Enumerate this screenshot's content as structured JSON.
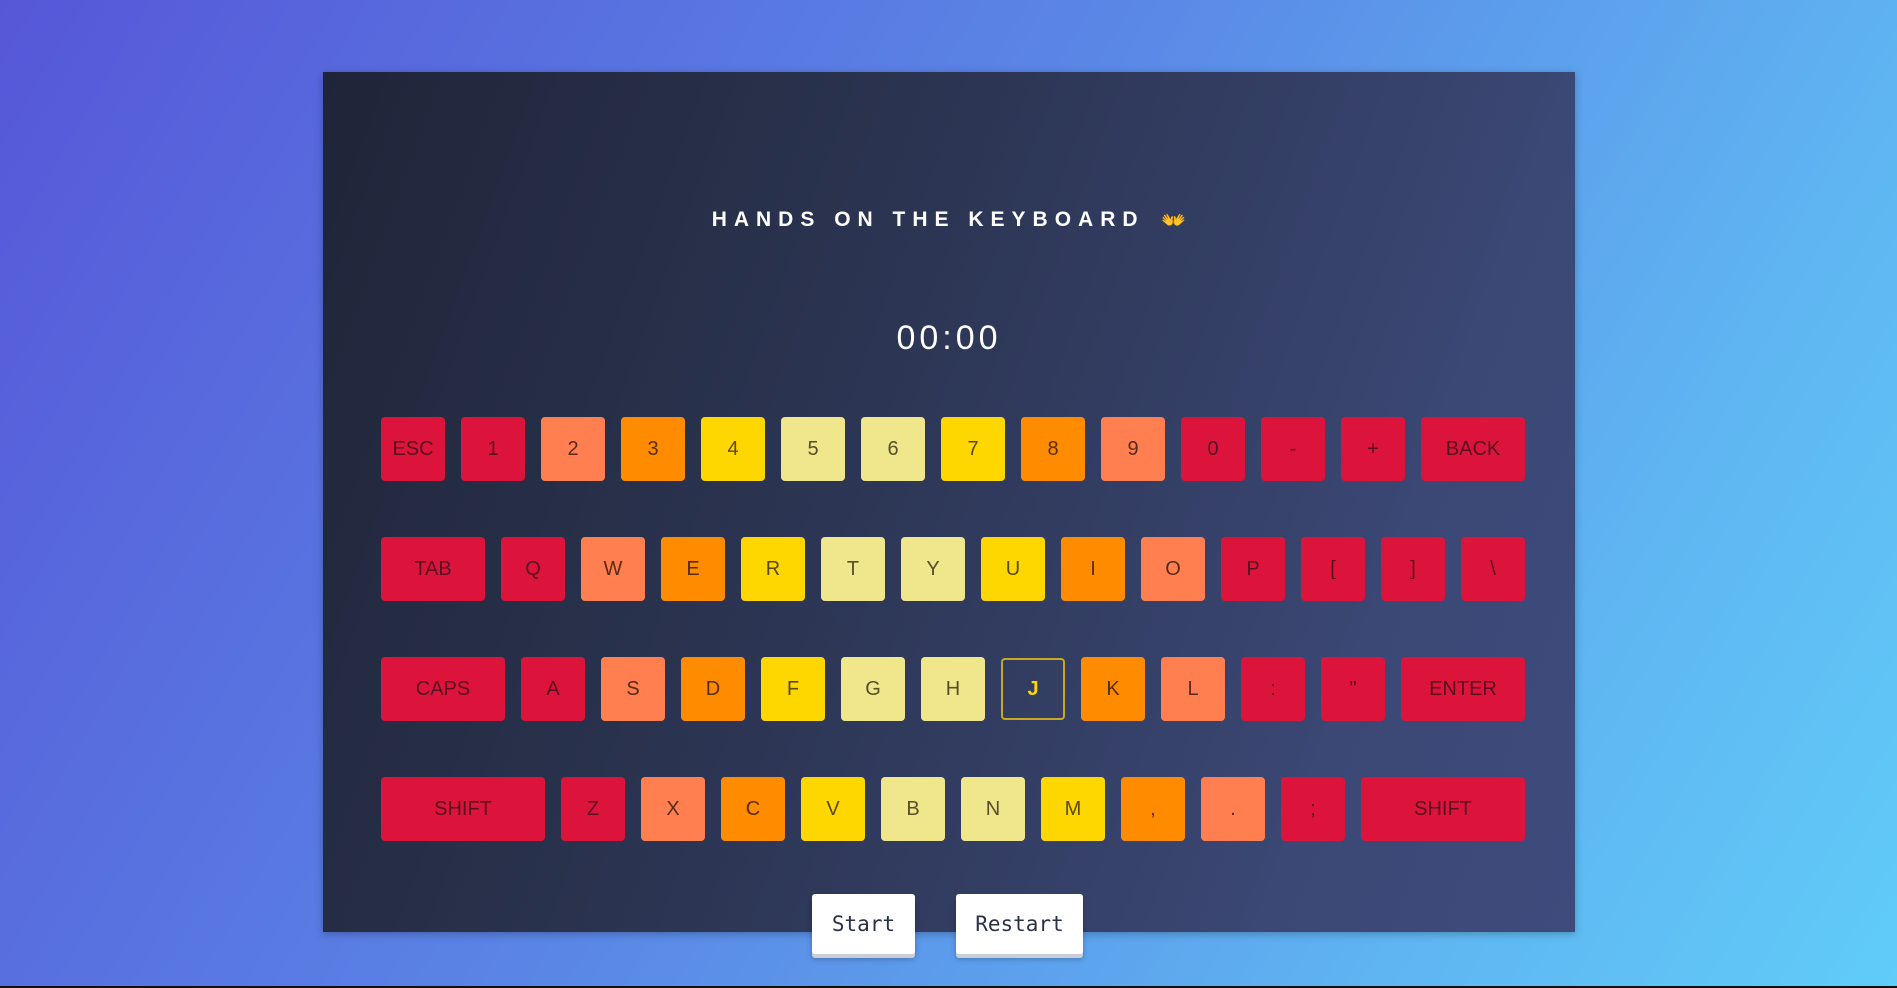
{
  "title": "HANDS ON THE KEYBOARD",
  "title_icon": "hands-icon",
  "title_icon_glyph": "👐",
  "timer": "00:00",
  "colors": {
    "red": "#dc143c",
    "coral": "#ff7f50",
    "orange": "#ff8c00",
    "gold": "#ffd700",
    "khaki": "#f0e68c"
  },
  "keyboard": {
    "rows": [
      {
        "keys": [
          {
            "label": "ESC",
            "color": "red"
          },
          {
            "label": "1",
            "color": "red"
          },
          {
            "label": "2",
            "color": "coral"
          },
          {
            "label": "3",
            "color": "orange"
          },
          {
            "label": "4",
            "color": "gold"
          },
          {
            "label": "5",
            "color": "khaki"
          },
          {
            "label": "6",
            "color": "khaki"
          },
          {
            "label": "7",
            "color": "gold"
          },
          {
            "label": "8",
            "color": "orange"
          },
          {
            "label": "9",
            "color": "coral"
          },
          {
            "label": "0",
            "color": "red"
          },
          {
            "label": "-",
            "color": "red"
          },
          {
            "label": "+",
            "color": "red"
          },
          {
            "label": "BACK",
            "color": "red"
          }
        ]
      },
      {
        "keys": [
          {
            "label": "TAB",
            "color": "red"
          },
          {
            "label": "Q",
            "color": "red"
          },
          {
            "label": "W",
            "color": "coral"
          },
          {
            "label": "E",
            "color": "orange"
          },
          {
            "label": "R",
            "color": "gold"
          },
          {
            "label": "T",
            "color": "khaki"
          },
          {
            "label": "Y",
            "color": "khaki"
          },
          {
            "label": "U",
            "color": "gold"
          },
          {
            "label": "I",
            "color": "orange"
          },
          {
            "label": "O",
            "color": "coral"
          },
          {
            "label": "P",
            "color": "red"
          },
          {
            "label": "[",
            "color": "red"
          },
          {
            "label": "]",
            "color": "red"
          },
          {
            "label": "\\",
            "color": "red"
          }
        ]
      },
      {
        "keys": [
          {
            "label": "CAPS",
            "color": "red"
          },
          {
            "label": "A",
            "color": "red"
          },
          {
            "label": "S",
            "color": "coral"
          },
          {
            "label": "D",
            "color": "orange"
          },
          {
            "label": "F",
            "color": "gold"
          },
          {
            "label": "G",
            "color": "khaki"
          },
          {
            "label": "H",
            "color": "khaki"
          },
          {
            "label": "J",
            "color": "active"
          },
          {
            "label": "K",
            "color": "orange"
          },
          {
            "label": "L",
            "color": "coral"
          },
          {
            "label": ":",
            "color": "red"
          },
          {
            "label": "\"",
            "color": "red"
          },
          {
            "label": "ENTER",
            "color": "red"
          }
        ]
      },
      {
        "keys": [
          {
            "label": "SHIFT",
            "color": "red"
          },
          {
            "label": "Z",
            "color": "red"
          },
          {
            "label": "X",
            "color": "coral"
          },
          {
            "label": "C",
            "color": "orange"
          },
          {
            "label": "V",
            "color": "gold"
          },
          {
            "label": "B",
            "color": "khaki"
          },
          {
            "label": "N",
            "color": "khaki"
          },
          {
            "label": "M",
            "color": "gold"
          },
          {
            "label": ",",
            "color": "orange"
          },
          {
            "label": ".",
            "color": "coral"
          },
          {
            "label": ";",
            "color": "red"
          },
          {
            "label": "SHIFT",
            "color": "red"
          }
        ]
      }
    ]
  },
  "buttons": {
    "start_label": "Start",
    "restart_label": "Restart"
  }
}
